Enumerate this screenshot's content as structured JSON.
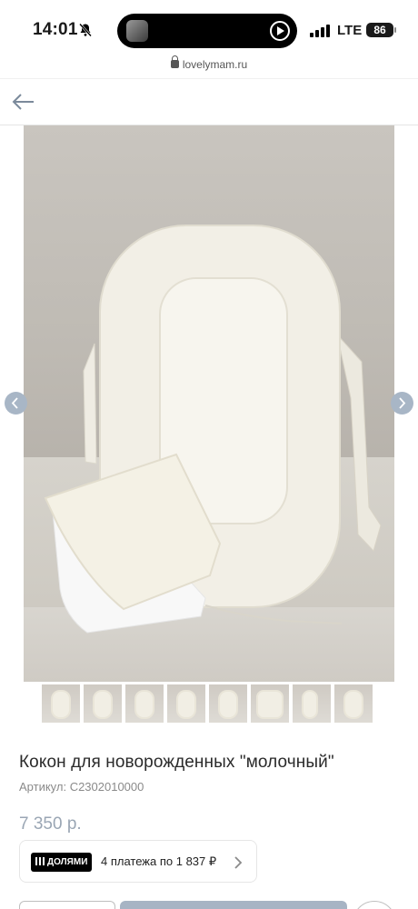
{
  "status_bar": {
    "time": "14:01",
    "network": "LTE",
    "battery": "86"
  },
  "browser": {
    "url": "lovelymam.ru"
  },
  "icons": {
    "back": "arrow-left-icon",
    "bell": "bell-slash-icon",
    "lock": "lock-icon",
    "prev": "chevron-left-icon",
    "next": "chevron-right-icon"
  },
  "colors": {
    "accent": "#a7b4c4",
    "price": "#9aa6b4"
  },
  "product": {
    "title": "Кокон для новорожденных \"молочный\"",
    "sku": "Артикул: С2302010000",
    "price": "7 350 р.",
    "thumbnail_count": 8
  },
  "dolyami": {
    "badge": "ДОЛЯМИ",
    "text": "4 платежа по 1 837 ₽"
  }
}
